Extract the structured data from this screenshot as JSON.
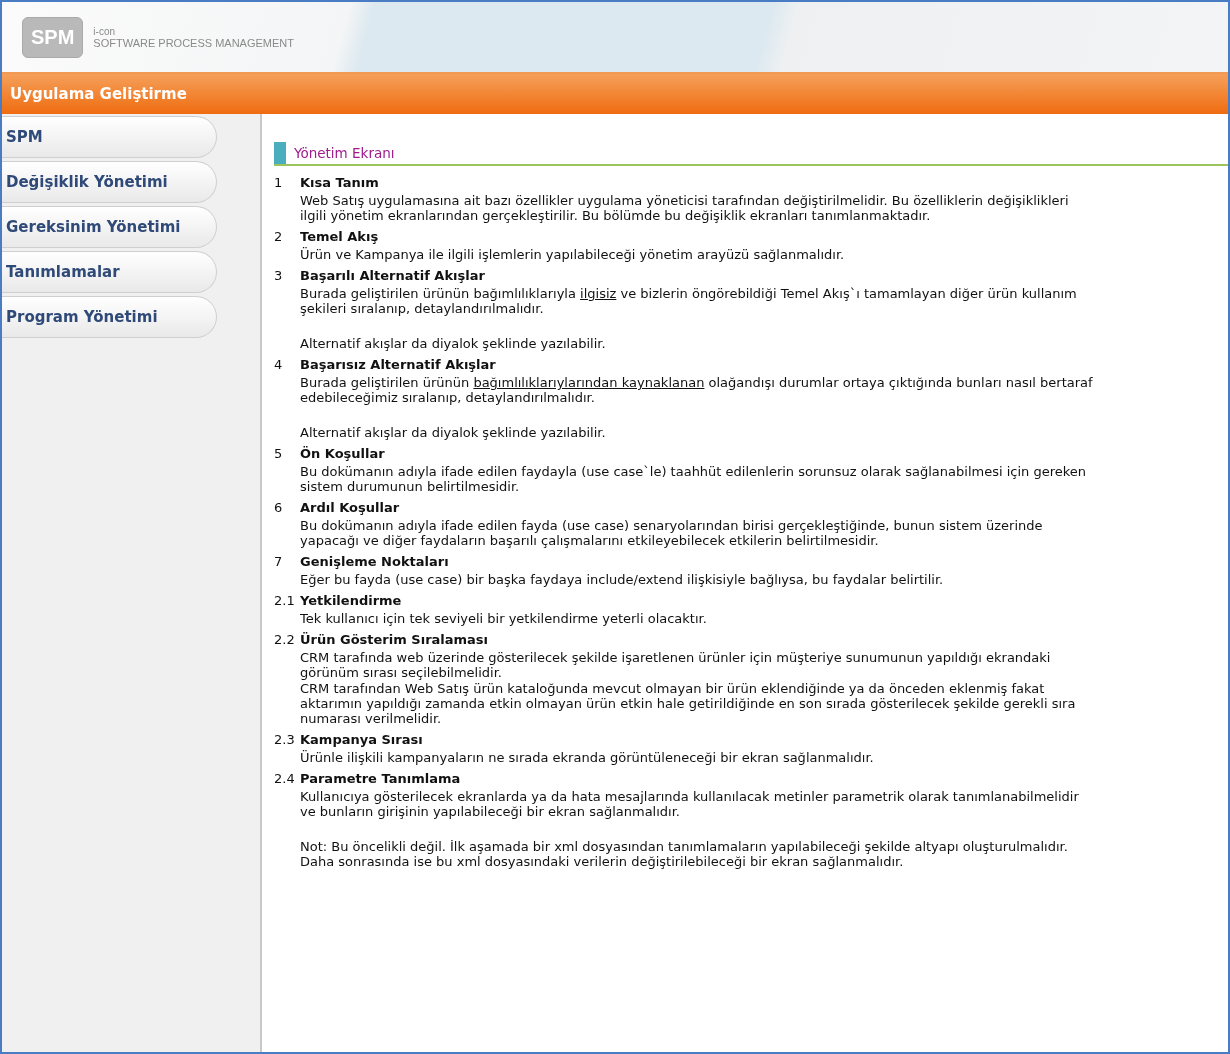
{
  "header": {
    "logo": "SPM",
    "company": "i-con",
    "tagline": "SOFTWARE PROCESS MANAGEMENT"
  },
  "title_bar": "Uygulama Geliştirme",
  "sidebar": {
    "items": [
      {
        "label": "SPM",
        "selected": false
      },
      {
        "label": "Değişiklik Yönetimi",
        "selected": false
      },
      {
        "label": "Gereksinim Yönetimi",
        "selected": false
      },
      {
        "label": "Tanımlamalar",
        "selected": false
      },
      {
        "label": "Program Yönetimi",
        "selected": false
      }
    ]
  },
  "content": {
    "heading": "Yönetim Ekranı",
    "sections": [
      {
        "number": "1",
        "title": "Kısa Tanım",
        "paragraphs": [
          {
            "spaced": false,
            "parts": [
              {
                "text": "Web Satış uygulamasına ait bazı özellikler uygulama yöneticisi tarafından değiştirilmelidir. Bu özelliklerin değişiklikleri ilgili yönetim ekranlarından gerçekleştirilir. Bu bölümde bu değişiklik ekranları tanımlanmaktadır.",
                "underline": false
              }
            ]
          }
        ]
      },
      {
        "number": "2",
        "title": "Temel Akış",
        "paragraphs": [
          {
            "spaced": false,
            "parts": [
              {
                "text": "Ürün ve Kampanya ile ilgili işlemlerin yapılabileceği yönetim arayüzü sağlanmalıdır.",
                "underline": false
              }
            ]
          }
        ]
      },
      {
        "number": "3",
        "title": "Başarılı Alternatif Akışlar",
        "paragraphs": [
          {
            "spaced": false,
            "parts": [
              {
                "text": "Burada geliştirilen ürünün bağımlılıklarıyla ",
                "underline": false
              },
              {
                "text": "ilgisiz",
                "underline": true
              },
              {
                "text": " ve bizlerin öngörebildiği Temel Akış`ı tamamlayan diğer ürün kullanım şekileri sıralanıp, detaylandırılmalıdır.",
                "underline": false
              }
            ]
          },
          {
            "spaced": true,
            "parts": [
              {
                "text": "Alternatif akışlar da diyalok şeklinde yazılabilir.",
                "underline": false
              }
            ]
          }
        ]
      },
      {
        "number": "4",
        "title": "Başarısız Alternatif Akışlar",
        "paragraphs": [
          {
            "spaced": false,
            "parts": [
              {
                "text": "Burada geliştirilen ürünün ",
                "underline": false
              },
              {
                "text": "bağımlılıklarıylarından kaynaklanan",
                "underline": true
              },
              {
                "text": " olağandışı durumlar ortaya çıktığında bunları nasıl bertaraf edebileceğimiz sıralanıp, detaylandırılmalıdır.",
                "underline": false
              }
            ]
          },
          {
            "spaced": true,
            "parts": [
              {
                "text": "Alternatif akışlar da diyalok şeklinde yazılabilir.",
                "underline": false
              }
            ]
          }
        ]
      },
      {
        "number": "5",
        "title": "Ön Koşullar",
        "paragraphs": [
          {
            "spaced": false,
            "parts": [
              {
                "text": "Bu dokümanın adıyla ifade edilen faydayla (use case`le) taahhüt edilenlerin sorunsuz olarak sağlanabilmesi için gereken sistem durumunun belirtilmesidir.",
                "underline": false
              }
            ]
          }
        ]
      },
      {
        "number": "6",
        "title": "Ardıl Koşullar",
        "paragraphs": [
          {
            "spaced": false,
            "parts": [
              {
                "text": "Bu dokümanın adıyla ifade edilen fayda (use case) senaryolarından birisi gerçekleştiğinde, bunun sistem üzerinde yapacağı ve diğer faydaların başarılı çalışmalarını etkileyebilecek etkilerin belirtilmesidir.",
                "underline": false
              }
            ]
          }
        ]
      },
      {
        "number": "7",
        "title": "Genişleme Noktaları",
        "paragraphs": [
          {
            "spaced": false,
            "parts": [
              {
                "text": "Eğer bu fayda (use case) bir başka faydaya include/extend ilişkisiyle bağlıysa, bu faydalar belirtilir.",
                "underline": false
              }
            ]
          }
        ]
      },
      {
        "number": "2.1",
        "title": "Yetkilendirme",
        "paragraphs": [
          {
            "spaced": false,
            "parts": [
              {
                "text": "Tek kullanıcı için tek seviyeli bir yetkilendirme yeterli olacaktır.",
                "underline": false
              }
            ]
          }
        ]
      },
      {
        "number": "2.2",
        "title": "Ürün Gösterim Sıralaması",
        "paragraphs": [
          {
            "spaced": false,
            "parts": [
              {
                "text": "CRM tarafında web üzerinde gösterilecek şekilde işaretlenen ürünler için müşteriye sunumunun yapıldığı ekrandaki görünüm sırası seçilebilmelidir.",
                "underline": false
              }
            ]
          },
          {
            "spaced": false,
            "parts": [
              {
                "text": "CRM tarafından Web Satış ürün kataloğunda mevcut olmayan bir ürün eklendiğinde ya da önceden eklenmiş fakat aktarımın yapıldığı zamanda etkin olmayan ürün etkin hale getirildiğinde en son sırada gösterilecek şekilde gerekli sıra numarası verilmelidir.",
                "underline": false
              }
            ]
          }
        ]
      },
      {
        "number": "2.3",
        "title": "Kampanya Sırası",
        "paragraphs": [
          {
            "spaced": false,
            "parts": [
              {
                "text": "Ürünle ilişkili kampanyaların ne sırada ekranda görüntüleneceği bir ekran sağlanmalıdır.",
                "underline": false
              }
            ]
          }
        ]
      },
      {
        "number": "2.4",
        "title": "Parametre Tanımlama",
        "paragraphs": [
          {
            "spaced": false,
            "parts": [
              {
                "text": "Kullanıcıya gösterilecek ekranlarda ya da hata mesajlarında kullanılacak metinler parametrik olarak tanımlanabilmelidir ve bunların girişinin yapılabileceği bir ekran sağlanmalıdır.",
                "underline": false
              }
            ]
          },
          {
            "spaced": true,
            "parts": [
              {
                "text": "Not: Bu öncelikli değil. İlk aşamada bir xml dosyasından tanımlamaların yapılabileceği şekilde altyapı oluşturulmalıdır. Daha sonrasında ise bu xml dosyasındaki verilerin değiştirilebileceği bir ekran sağlanmalıdır.",
                "underline": false
              }
            ]
          }
        ]
      }
    ]
  }
}
